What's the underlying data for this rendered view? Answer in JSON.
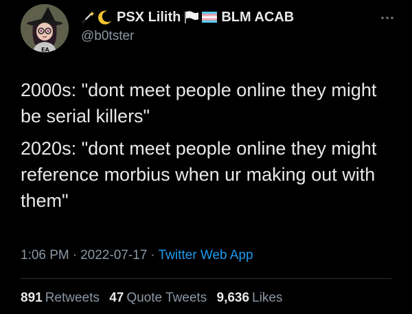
{
  "author": {
    "display_name_part1": "PSX Lilith",
    "display_name_part2": "BLM ACAB",
    "handle": "@b0tster",
    "name_icons": [
      "magic-wand-icon",
      "crescent-moon-icon",
      "white-flag-icon",
      "transgender-flag-icon"
    ],
    "avatar_text": "EA"
  },
  "tweet": {
    "paragraph1": "2000s: \"dont meet people online they might be serial killers\"",
    "paragraph2": "2020s: \"dont meet people online they might reference morbius when ur making out with them\""
  },
  "meta": {
    "time": "1:06 PM",
    "separator": "·",
    "date": "2022-07-17",
    "source": "Twitter Web App"
  },
  "stats": {
    "retweets_count": "891",
    "retweets_label": "Retweets",
    "quotes_count": "47",
    "quotes_label": "Quote Tweets",
    "likes_count": "9,636",
    "likes_label": "Likes"
  },
  "colors": {
    "background": "#000000",
    "text_primary": "#e7e9ea",
    "text_secondary": "#8b98a5",
    "link": "#1d9bf0",
    "divider": "#2f3336"
  }
}
